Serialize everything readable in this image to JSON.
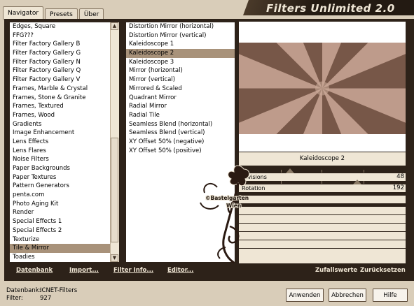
{
  "tabs": [
    {
      "label": "Navigator",
      "active": true
    },
    {
      "label": "Presets",
      "active": false
    },
    {
      "label": "Über",
      "active": false
    }
  ],
  "title": "Filters Unlimited 2.0",
  "categories": {
    "items": [
      "Edges, Square",
      "FFG???",
      "Filter Factory Gallery B",
      "Filter Factory Gallery G",
      "Filter Factory Gallery N",
      "Filter Factory Gallery Q",
      "Filter Factory Gallery V",
      "Frames, Marble & Crystal",
      "Frames, Stone & Granite",
      "Frames, Textured",
      "Frames, Wood",
      "Gradients",
      "Image Enhancement",
      "Lens Effects",
      "Lens Flares",
      "Noise Filters",
      "Paper Backgrounds",
      "Paper Textures",
      "Pattern Generators",
      "penta.com",
      "Photo Aging Kit",
      "Render",
      "Special Effects 1",
      "Special Effects 2",
      "Texturize",
      "Tile & Mirror",
      "Toadies"
    ],
    "selected": "Tile & Mirror"
  },
  "filters": {
    "items": [
      "Distortion Mirror (horizontal)",
      "Distortion Mirror (vertical)",
      "Kaleidoscope 1",
      "Kaleidoscope 2",
      "Kaleidoscope 3",
      "Mirror (horizontal)",
      "Mirror (vertical)",
      "Mirrored & Scaled",
      "Quadrant Mirror",
      "Radial Mirror",
      "Radial Tile",
      "Seamless Blend (horizontal)",
      "Seamless Blend (vertical)",
      "XY Offset 50% (negative)",
      "XY Offset 50% (positive)"
    ],
    "selected": "Kaleidoscope 2"
  },
  "preview": {
    "caption": "Kaleidoscope 2",
    "colors": {
      "dark": "#6b4d3f",
      "light": "#c9a898",
      "mid": "#9a7565"
    }
  },
  "params": [
    {
      "label": "Divisions",
      "value": "48",
      "fraction": 0.19
    },
    {
      "label": "Rotation",
      "value": "192",
      "fraction": 0.75
    }
  ],
  "watermark": {
    "line1": "©Bastelgarten",
    "line2": "Wien"
  },
  "toolbar": {
    "datenbank": "Datenbank",
    "import": "Import...",
    "filter_info": "Filter Info...",
    "editor": "Editor...",
    "zufallswerte": "Zufallswerte",
    "zuruecksetzen": "Zurücksetzen"
  },
  "status": {
    "datenbank_label": "Datenbank:",
    "datenbank_value": "ICNET-Filters",
    "filter_label": "Filter:",
    "filter_value": "927"
  },
  "buttons": {
    "apply": "Anwenden",
    "cancel": "Abbrechen",
    "help": "Hilfe"
  }
}
